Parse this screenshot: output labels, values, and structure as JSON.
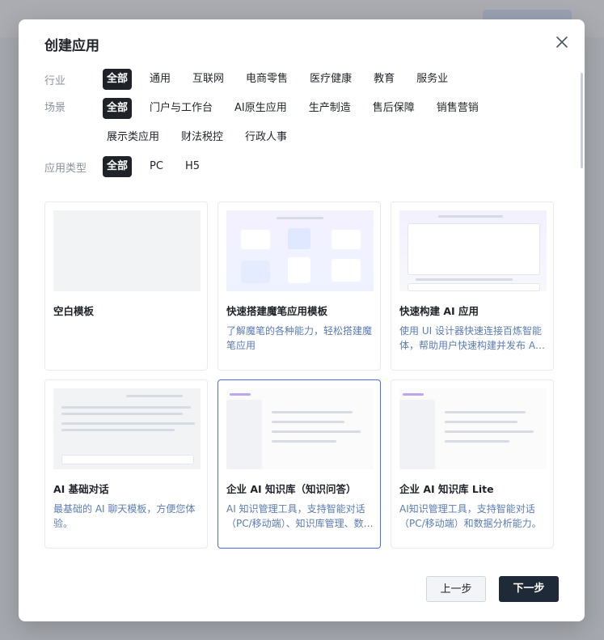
{
  "dialog": {
    "title": "创建应用"
  },
  "filters": {
    "industry": {
      "label": "行业",
      "options": [
        "全部",
        "通用",
        "互联网",
        "电商零售",
        "医疗健康",
        "教育",
        "服务业"
      ],
      "selected": "全部"
    },
    "scene": {
      "label": "场景",
      "options": [
        "全部",
        "门户与工作台",
        "AI原生应用",
        "生产制造",
        "售后保障",
        "销售营销",
        "展示类应用",
        "财法税控",
        "行政人事"
      ],
      "selected": "全部"
    },
    "app_type": {
      "label": "应用类型",
      "options": [
        "全部",
        "PC",
        "H5"
      ],
      "selected": "全部"
    }
  },
  "templates": [
    {
      "title": "空白模板",
      "desc": ""
    },
    {
      "title": "快速搭建魔笔应用模板",
      "desc": "了解魔笔的各种能力，轻松搭建魔笔应用"
    },
    {
      "title": "快速构建 AI 应用",
      "desc": "使用 UI 设计器快速连接百炼智能体，帮助用户快速构建并发布 AI 应用"
    },
    {
      "title": "AI 基础对话",
      "desc": "最基础的 AI 聊天模板，方便您体验。"
    },
    {
      "title": "企业 AI 知识库（知识问答）",
      "desc": "AI 知识管理工具，支持智能对话（PC/移动端）、知识库管理、数据分析"
    },
    {
      "title": "企业 AI 知识库 Lite",
      "desc": "AI知识管理工具，支持智能对话（PC/移动端）和数据分析能力。"
    }
  ],
  "footer": {
    "prev_label": "上一步",
    "next_label": "下一步"
  },
  "colors": {
    "accent": "#1f2329",
    "selected_border": "#4a6fe3",
    "desc_text": "#5b7cb4"
  }
}
